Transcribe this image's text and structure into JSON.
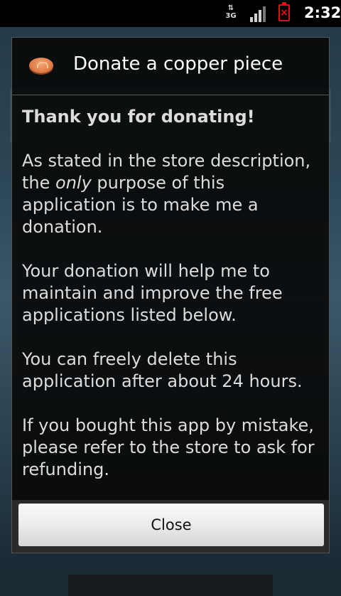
{
  "status_bar": {
    "network": "3G",
    "time": "2:32"
  },
  "dialog": {
    "title": "Donate a copper piece",
    "icon": "copper-coin-icon",
    "heading": "Thank you for donating!",
    "paragraph1_before": "As stated in the store description, the ",
    "paragraph1_emphasis": "only",
    "paragraph1_after": " purpose of this application is to make me a donation.",
    "paragraph2": "Your donation will help me to maintain and improve the free applications listed below.",
    "paragraph3": "You can freely delete this application after about 24 hours.",
    "paragraph4": "If you bought this app by mistake, please refer to the store to ask for refunding.",
    "close_label": "Close"
  }
}
